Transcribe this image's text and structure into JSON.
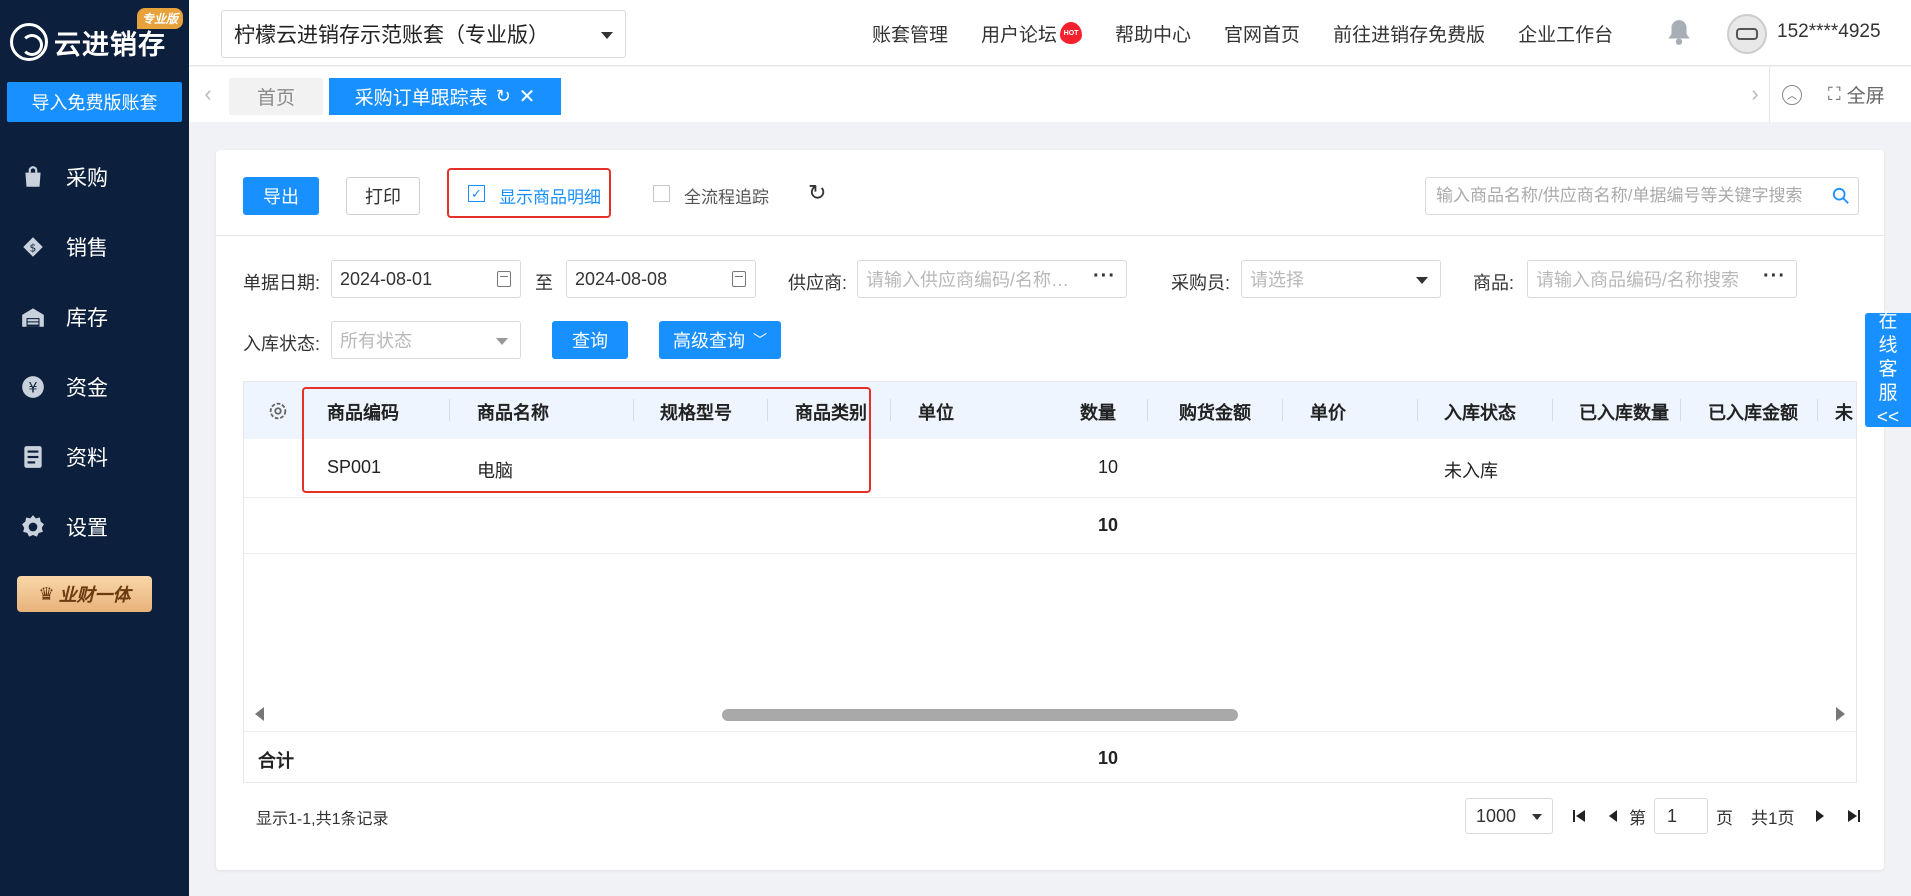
{
  "sidebar": {
    "logo_text": "云进销存",
    "edition_badge": "专业版",
    "import_button": "导入免费版账套",
    "items": [
      {
        "label": "采购",
        "icon": "shopping-bag-icon"
      },
      {
        "label": "销售",
        "icon": "sales-tag-icon"
      },
      {
        "label": "库存",
        "icon": "warehouse-icon"
      },
      {
        "label": "资金",
        "icon": "yen-coin-icon"
      },
      {
        "label": "资料",
        "icon": "document-icon"
      },
      {
        "label": "设置",
        "icon": "gear-icon"
      }
    ],
    "finance_badge": "业财一体"
  },
  "header": {
    "account_name": "柠檬云进销存示范账套（专业版）",
    "links": [
      "账套管理",
      "用户论坛",
      "帮助中心",
      "官网首页",
      "前往进销存免费版",
      "企业工作台"
    ],
    "hot_label": "HOT",
    "user_phone": "152****4925"
  },
  "tabs": {
    "home": "首页",
    "active": "采购订单跟踪表",
    "fullscreen": "全屏"
  },
  "toolbar": {
    "export": "导出",
    "print": "打印",
    "show_detail": {
      "label": "显示商品明细",
      "checked": true
    },
    "full_trace": {
      "label": "全流程追踪",
      "checked": false
    },
    "search_placeholder": "输入商品名称/供应商名称/单据编号等关键字搜索"
  },
  "filters": {
    "date_label": "单据日期:",
    "date_from": "2024-08-01",
    "to_label": "至",
    "date_to": "2024-08-08",
    "supplier_label": "供应商:",
    "supplier_placeholder": "请输入供应商编码/名称…",
    "buyer_label": "采购员:",
    "buyer_placeholder": "请选择",
    "goods_label": "商品:",
    "goods_placeholder": "请输入商品编码/名称搜索",
    "status_label": "入库状态:",
    "status_placeholder": "所有状态",
    "query_button": "查询",
    "advanced_button": "高级查询"
  },
  "table": {
    "columns": [
      "商品编码",
      "商品名称",
      "规格型号",
      "商品类别",
      "单位",
      "数量",
      "购货金额",
      "单价",
      "入库状态",
      "已入库数量",
      "已入库金额",
      "未"
    ],
    "rows": [
      {
        "code": "SP001",
        "name": "电脑",
        "spec": "",
        "category": "",
        "unit": "",
        "qty": "10",
        "amount": "",
        "price": "",
        "status": "未入库"
      }
    ],
    "subtotal_qty": "10",
    "total_label": "合计",
    "total_qty": "10"
  },
  "pager": {
    "info": "显示1-1,共1条记录",
    "page_size": "1000",
    "page_prefix": "第",
    "page_value": "1",
    "page_suffix": "页",
    "total_pages": "共1页"
  },
  "service_tab": {
    "chars": [
      "在",
      "线",
      "客",
      "服"
    ],
    "arrow": "<<"
  },
  "colors": {
    "sidebar_bg": "#0c1f3c",
    "primary": "#1890ff",
    "highlight": "#e8302a",
    "header_row_bg": "#eef5fe"
  }
}
